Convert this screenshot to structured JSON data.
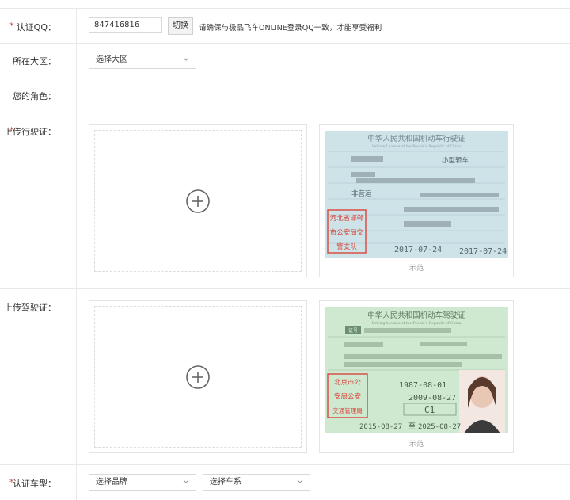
{
  "form": {
    "qq": {
      "required_mark": "*",
      "label": "认证QQ：",
      "value": "847416816",
      "switch_label": "切换",
      "tip": "请确保与极品飞车ONLINE登录QQ一致，才能享受福利"
    },
    "region": {
      "label": "所在大区：",
      "selected": "选择大区"
    },
    "role": {
      "label": "您的角色："
    },
    "vehicle_license": {
      "required_mark": "*",
      "label": "上传行驶证：",
      "sample_caption": "示范",
      "sample": {
        "title": "中华人民共和国机动车行驶证",
        "subtitle": "Vehicle License of the People's Republic of China",
        "vehicle_type": "小型轿车",
        "use_character": "非营运",
        "stamp": [
          "河北省邯郸",
          "市公安局交",
          "警支队"
        ],
        "register_date": "2017-07-24",
        "issue_date": "2017-07-24"
      }
    },
    "driving_license": {
      "label": "上传驾驶证：",
      "sample_caption": "示范",
      "sample": {
        "title": "中华人民共和国机动车驾驶证",
        "subtitle": "Driving License of the People's Republic of China",
        "badge": "证号",
        "birth_date": "1987-08-01",
        "first_issue": "2009-08-27",
        "class": "C1",
        "valid_from": "2015-08-27",
        "valid_to_word": "至",
        "valid_to": "2025-08-27",
        "stamp": [
          "北京市公",
          "安局公安",
          "交通管理局"
        ]
      }
    },
    "car_model": {
      "required_mark": "*",
      "label": "认证车型：",
      "brand_selected": "选择品牌",
      "series_selected": "选择车系"
    }
  },
  "colors": {
    "required": "#e4393c",
    "border": "#e8e8e8",
    "vehicle_card": "#cfe3e8",
    "driving_card": "#cde8cf",
    "stamp": "#d9443c"
  }
}
